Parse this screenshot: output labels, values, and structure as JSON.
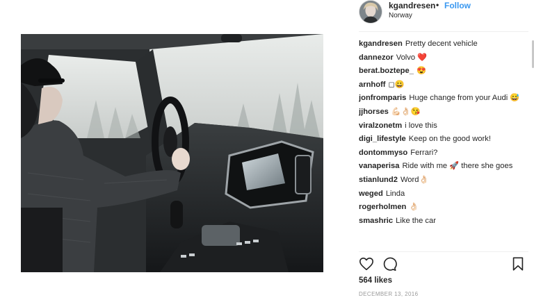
{
  "post": {
    "username": "kgandresen",
    "separator": "•",
    "follow_label": "Follow",
    "location": "Norway",
    "likes": "564 likes",
    "date": "DECEMBER 13, 2016"
  },
  "comments": [
    {
      "user": "kgandresen",
      "text": "Pretty decent vehicle"
    },
    {
      "user": "dannezor",
      "text": "Volvo ❤️"
    },
    {
      "user": "berat.boztepe_",
      "text": "😍"
    },
    {
      "user": "arnhoff",
      "text": "◻😀"
    },
    {
      "user": "jonfromparis",
      "text": "Huge change from your Audi 😅"
    },
    {
      "user": "jjhorses",
      "text": "💪🏻👌🏻😘"
    },
    {
      "user": "viralzonetm",
      "text": "i love this"
    },
    {
      "user": "digi_lifestyle",
      "text": "Keep on the good work!"
    },
    {
      "user": "dontommyso",
      "text": "Ferrari?"
    },
    {
      "user": "vanaperisa",
      "text": "Ride with me 🚀 there she goes"
    },
    {
      "user": "stianlund2",
      "text": "Word👌🏻"
    },
    {
      "user": "weged",
      "text": "Linda"
    },
    {
      "user": "rogerholmen",
      "text": "👌🏻"
    },
    {
      "user": "smashric",
      "text": "Like the car"
    }
  ],
  "icons": {
    "like": "heart-outline-icon",
    "comment": "speech-bubble-icon",
    "save": "bookmark-icon"
  },
  "colors": {
    "link": "#3897f0",
    "text": "#262626",
    "muted": "#999999"
  }
}
